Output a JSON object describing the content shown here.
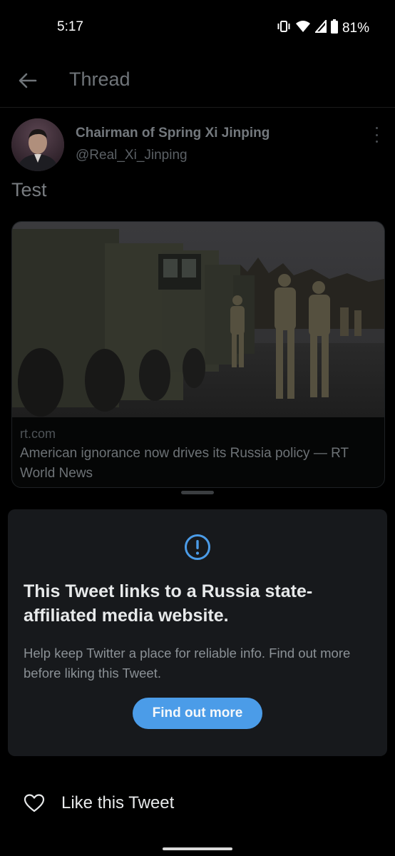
{
  "status_bar": {
    "time": "5:17",
    "battery_percent": "81%",
    "icons": [
      "vibrate-icon",
      "wifi-icon",
      "signal-icon",
      "battery-icon"
    ]
  },
  "header": {
    "title": "Thread",
    "back_icon": "arrow-left-icon"
  },
  "tweet": {
    "author_name": "Chairman of Spring Xi Jinping",
    "author_handle": "@Real_Xi_Jinping",
    "text": "Test",
    "more_icon": "kebab-menu-icon"
  },
  "link_card": {
    "domain": "rt.com",
    "title": "American ignorance now drives its Russia policy — RT World News",
    "image": "photo-military-vehicles-and-soldiers"
  },
  "warning": {
    "icon": "exclamation-circle-icon",
    "title": "This Tweet links to a Russia state-affiliated media website.",
    "body": "Help keep Twitter a place for reliable info. Find out more before liking this Tweet.",
    "button_label": "Find out more"
  },
  "actions": {
    "like_label": "Like this Tweet",
    "like_icon": "heart-outline-icon"
  },
  "colors": {
    "background": "#000000",
    "sheet_background": "#17191c",
    "accent_button": "#4b9ce8",
    "primary_text": "#e7e9ea",
    "secondary_text": "#8b9196"
  }
}
